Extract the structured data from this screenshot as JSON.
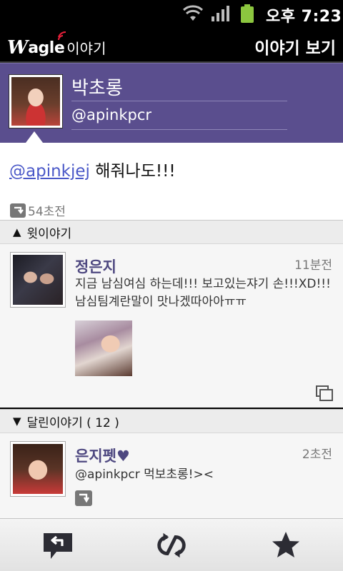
{
  "status_bar": {
    "time": "오후 7:23",
    "icons": [
      "wifi-icon",
      "signal-icon",
      "battery-icon"
    ],
    "battery_color": "#8cc63f"
  },
  "app_bar": {
    "logo_w": "W",
    "logo_agle": "agle",
    "logo_korean": "이야기",
    "title": "이야기 보기"
  },
  "profile": {
    "name": "박초롱",
    "handle": "@apinkpcr",
    "header_color": "#5a4e8e"
  },
  "tweet": {
    "mention": "@apinkjej",
    "text": "해줘나도!!!",
    "time": "54초전",
    "mention_color": "#4a58c8"
  },
  "sections": {
    "parent": {
      "label": "윗이야기"
    },
    "replies": {
      "label": "달린이야기 ( 12 )"
    }
  },
  "parent_item": {
    "name": "정은지",
    "time": "11분전",
    "text": "지금 남심여심 하는데!!! 보고있는쟈기 손!!!XD!!! 남심팀계란말이 맛나겠따아아ㅠㅠ"
  },
  "reply_item": {
    "name": "은지펫♥",
    "time": "2초전",
    "text": "@apinkpcr 먹보초롱!><"
  },
  "bottom_bar": {
    "icons": [
      "reply-icon",
      "retweet-icon",
      "favorite-star-icon"
    ]
  }
}
